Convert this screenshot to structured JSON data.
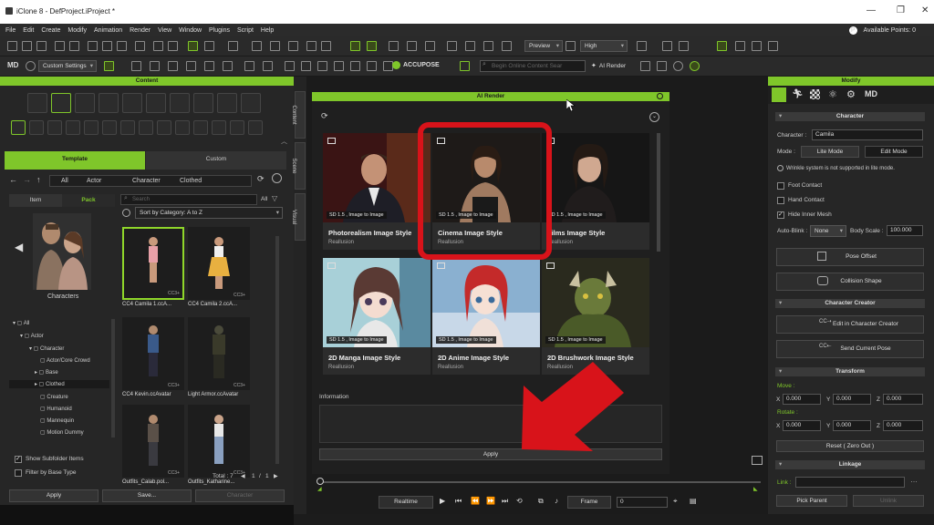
{
  "window": {
    "title": "iClone 8 - DefProject.iProject *"
  },
  "menu": {
    "items": [
      "File",
      "Edit",
      "Create",
      "Modify",
      "Animation",
      "Render",
      "View",
      "Window",
      "Plugins",
      "Script",
      "Help"
    ],
    "points_label": "Available Points: 0"
  },
  "toolbar1": {
    "preview_select": "Preview",
    "quality_select": "High"
  },
  "toolbar2": {
    "custom_settings": "Custom Settings",
    "accupose_label": "ACCUPOSE",
    "search_placeholder": "Begin Online Content Sear",
    "ai_render_label": "AI Render"
  },
  "content": {
    "title": "Content",
    "tabs": [
      "Template",
      "Custom"
    ],
    "breadcrumb": [
      "All",
      "Actor",
      "Character",
      "Clothed"
    ],
    "subtabs": [
      "Item",
      "Pack"
    ],
    "preview_label": "Characters",
    "search_placeholder": "Search",
    "filter_all": "All",
    "sort_label": "Sort by Category: A to Z",
    "tree": [
      "All",
      "Actor",
      "Character",
      "Actor/Core Crowd",
      "Base",
      "Clothed",
      "Creature",
      "Humanoid",
      "Mannequin",
      "Motion Dummy"
    ],
    "items": [
      "CC4 Camila 1.ccA...",
      "CC4 Camila 2.ccA...",
      "CC4 Kevin.ccAvatar",
      "Light Armor.ccAvatar",
      "Outfits_Calab.pol...",
      "Outfits_Katharine..."
    ],
    "show_subfolder": "Show Subfolder Items",
    "filter_base": "Filter by Base Type",
    "total_label": "Total : 7",
    "page_current": "1",
    "page_sep": "/",
    "page_total": "1",
    "buttons": [
      "Apply",
      "Save...",
      "Character"
    ]
  },
  "vtabs": [
    "Content",
    "Scene",
    "Visual"
  ],
  "ai_render": {
    "title": "AI Render",
    "cards": [
      {
        "title": "Photorealism Image Style",
        "sub": "Reallusion",
        "badge": "SD 1.5 , Image to Image"
      },
      {
        "title": "Cinema Image Style",
        "sub": "Reallusion",
        "badge": "SD 1.5 , Image to Image"
      },
      {
        "title": "Films Image Style",
        "sub": "Reallusion",
        "badge": "SD 1.5 , Image to Image"
      },
      {
        "title": "2D Manga Image Style",
        "sub": "Reallusion",
        "badge": "SD 1.5 , Image to Image"
      },
      {
        "title": "2D Anime Image Style",
        "sub": "Reallusion",
        "badge": "SD 1.5 , Image to Image"
      },
      {
        "title": "2D Brushwork Image Style",
        "sub": "Reallusion",
        "badge": "SD 1.5 , Image to Image"
      }
    ],
    "info_label": "Information",
    "apply_label": "Apply"
  },
  "timeline": {
    "mode": "Realtime",
    "frame_label": "Frame",
    "frame_value": "0"
  },
  "modify": {
    "title": "Modify",
    "sections": {
      "character": "Character",
      "creator": "Character Creator",
      "transform": "Transform",
      "linkage": "Linkage"
    },
    "character_label": "Character :",
    "character_value": "Camila",
    "mode_label": "Mode :",
    "lite_mode": "Lite Mode",
    "edit_mode": "Edit Mode",
    "warning": "Wrinkle system is not supported in lite mode.",
    "foot_contact": "Foot Contact",
    "hand_contact": "Hand Contact",
    "hide_inner_mesh": "Hide Inner Mesh",
    "autoblink_label": "Auto-Blink :",
    "autoblink_value": "None",
    "bodyscale_label": "Body Scale :",
    "bodyscale_value": "100.000",
    "pose_offset": "Pose Offset",
    "collision_shape": "Collision Shape",
    "edit_in_cc": "Edit in Character Creator",
    "send_pose": "Send Current Pose",
    "move_label": "Move :",
    "rotate_label": "Rotate :",
    "axis": [
      "X",
      "Y",
      "Z"
    ],
    "move_values": [
      "0.000",
      "0.000",
      "0.000"
    ],
    "rotate_values": [
      "0.000",
      "0.000",
      "0.000"
    ],
    "reset_label": "Reset ( Zero Out )",
    "link_label": "Link :",
    "pick_parent": "Pick Parent",
    "unlink": "Unlink"
  },
  "colors": {
    "accent": "#7fc62a",
    "highlight": "#d8131a"
  }
}
